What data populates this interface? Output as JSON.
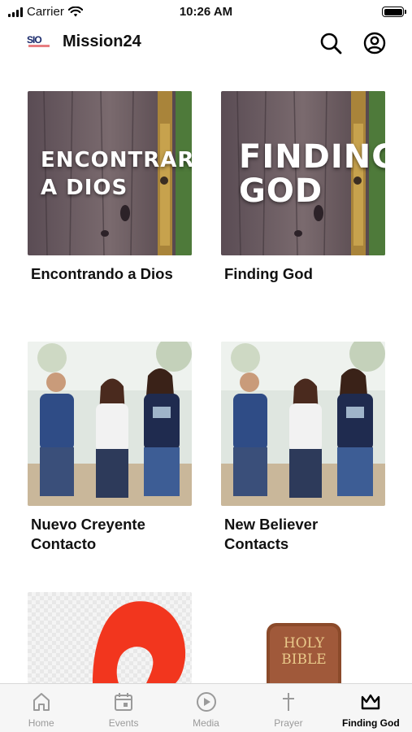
{
  "status_bar": {
    "carrier": "Carrier",
    "time": "10:26 AM"
  },
  "header": {
    "title": "Mission24",
    "logo_text": "SIO"
  },
  "cards": [
    {
      "title": "Encontrando a Dios",
      "overlay": [
        "ENCONTRAR",
        "A DIOS"
      ]
    },
    {
      "title": "Finding God",
      "overlay": [
        "FINDING",
        "GOD"
      ]
    },
    {
      "title": "Nuevo Creyente Contacto",
      "overlay": []
    },
    {
      "title": "New Believer Contacts",
      "overlay": []
    },
    {
      "title": "",
      "overlay": []
    },
    {
      "title": "",
      "overlay": [
        "HOLY",
        "BIBLE"
      ]
    }
  ],
  "tabs": [
    {
      "label": "Home",
      "icon": "home-icon",
      "active": false
    },
    {
      "label": "Events",
      "icon": "calendar-icon",
      "active": false
    },
    {
      "label": "Media",
      "icon": "play-icon",
      "active": false
    },
    {
      "label": "Prayer",
      "icon": "cross-icon",
      "active": false
    },
    {
      "label": "Finding God",
      "icon": "crown-icon",
      "active": true
    }
  ],
  "colors": {
    "accent": "#000000",
    "inactive_tab": "#9a9a9a",
    "tab_bar_bg": "#f6f6f6",
    "door_wood": "#6b5a5e",
    "jeans_blue": "#2f4c86",
    "red_shape": "#f2361e",
    "bible_brown": "#8b4a2a"
  }
}
